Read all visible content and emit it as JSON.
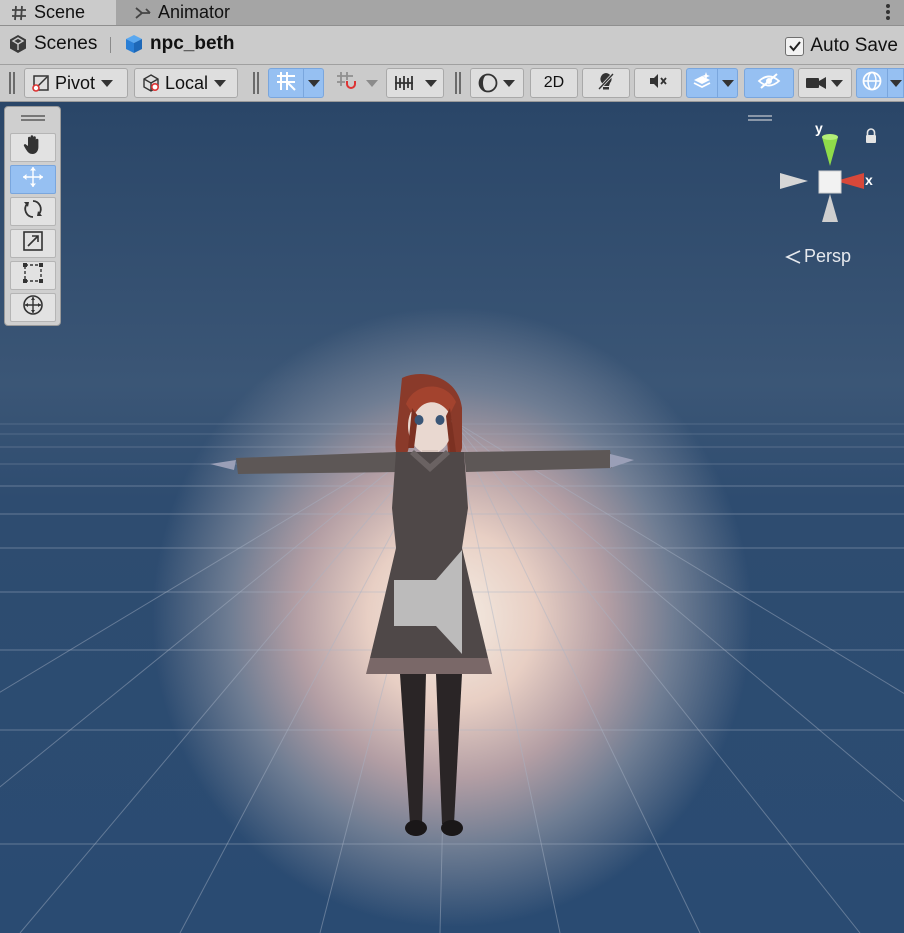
{
  "tabs": [
    {
      "label": "Scene",
      "icon": "grid-hash-icon",
      "active": true
    },
    {
      "label": "Animator",
      "icon": "animator-icon",
      "active": false
    }
  ],
  "breadcrumb": {
    "root": "Scenes",
    "current": "npc_beth"
  },
  "autosave": {
    "label": "Auto Save",
    "checked": true
  },
  "toolbar": {
    "pivot_label": "Pivot",
    "local_label": "Local",
    "mode_2d_label": "2D"
  },
  "tools": [
    {
      "name": "hand-tool",
      "icon": "hand-icon",
      "active": false
    },
    {
      "name": "move-tool",
      "icon": "move-icon",
      "active": true
    },
    {
      "name": "rotate-tool",
      "icon": "rotate-icon",
      "active": false
    },
    {
      "name": "scale-tool",
      "icon": "scale-icon",
      "active": false
    },
    {
      "name": "rect-tool",
      "icon": "rect-icon",
      "active": false
    },
    {
      "name": "transform-tool",
      "icon": "transform-icon",
      "active": false
    }
  ],
  "gizmo": {
    "y_label": "y",
    "x_label": "x",
    "projection_label": "Persp"
  },
  "colors": {
    "accent": "#96c0f2",
    "axis_y": "#8fdc4a",
    "axis_x": "#d8483a",
    "scene_sky": "#2e4c70"
  }
}
